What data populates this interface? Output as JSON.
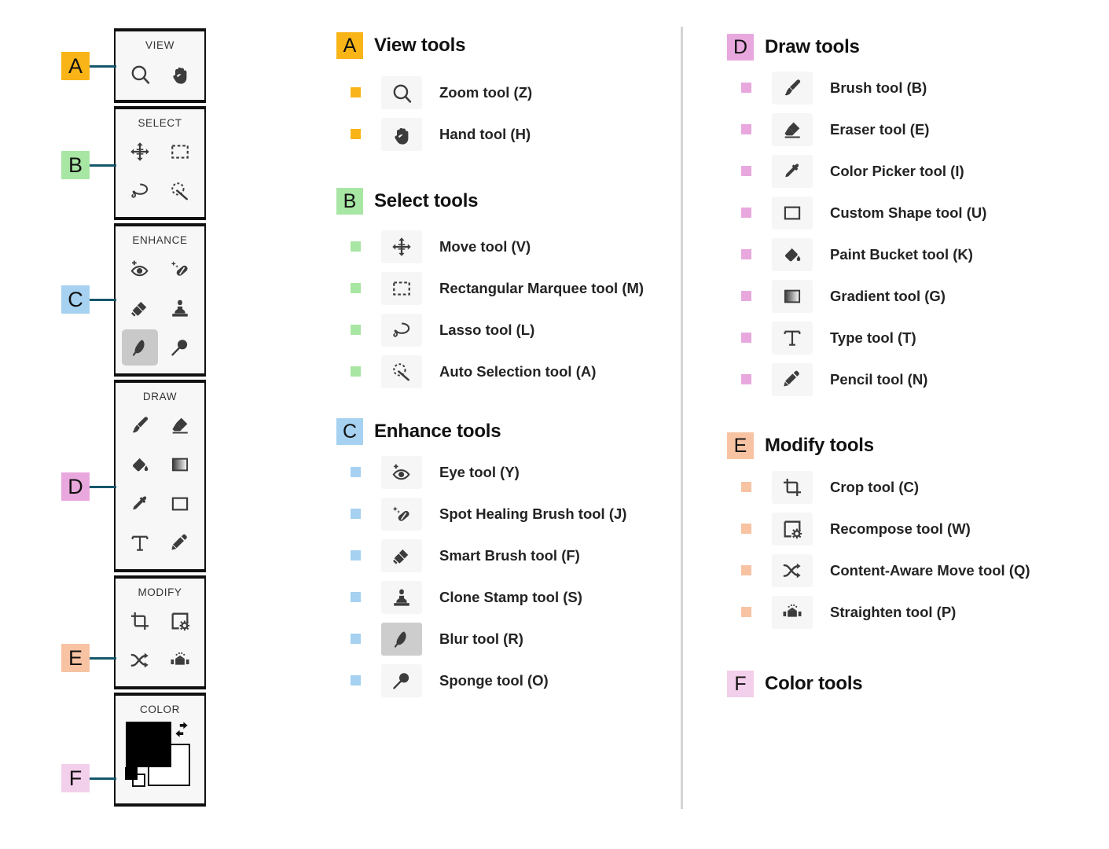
{
  "figure": {
    "type": "annotated-toolbar-diagram",
    "toolbar": {
      "panels": [
        {
          "key": "view",
          "title": "VIEW",
          "callout": "A",
          "callout_color": "#f9b418",
          "tools": [
            {
              "name": "zoom-tool-icon",
              "active": false
            },
            {
              "name": "hand-tool-icon",
              "active": false
            }
          ]
        },
        {
          "key": "select",
          "title": "SELECT",
          "callout": "B",
          "callout_color": "#a8e6a3",
          "tools": [
            {
              "name": "move-tool-icon",
              "active": false
            },
            {
              "name": "rectangular-marquee-tool-icon",
              "active": false
            },
            {
              "name": "lasso-tool-icon",
              "active": false
            },
            {
              "name": "auto-selection-tool-icon",
              "active": false
            }
          ]
        },
        {
          "key": "enhance",
          "title": "ENHANCE",
          "callout": "C",
          "callout_color": "#a6d1f0",
          "tools": [
            {
              "name": "eye-tool-icon",
              "active": false
            },
            {
              "name": "spot-healing-brush-tool-icon",
              "active": false
            },
            {
              "name": "smart-brush-tool-icon",
              "active": false
            },
            {
              "name": "clone-stamp-tool-icon",
              "active": false
            },
            {
              "name": "blur-tool-icon",
              "active": true
            },
            {
              "name": "sponge-tool-icon",
              "active": false
            }
          ]
        },
        {
          "key": "draw",
          "title": "DRAW",
          "callout": "D",
          "callout_color": "#e8a8dd",
          "tools": [
            {
              "name": "brush-tool-icon",
              "active": false
            },
            {
              "name": "eraser-tool-icon",
              "active": false
            },
            {
              "name": "paint-bucket-tool-icon",
              "active": false
            },
            {
              "name": "gradient-tool-icon",
              "active": false
            },
            {
              "name": "color-picker-tool-icon",
              "active": false
            },
            {
              "name": "custom-shape-tool-icon",
              "active": false
            },
            {
              "name": "type-tool-icon",
              "active": false
            },
            {
              "name": "pencil-tool-icon",
              "active": false
            }
          ]
        },
        {
          "key": "modify",
          "title": "MODIFY",
          "callout": "E",
          "callout_color": "#f7c3a3",
          "tools": [
            {
              "name": "crop-tool-icon",
              "active": false
            },
            {
              "name": "recompose-tool-icon",
              "active": false
            },
            {
              "name": "content-aware-move-tool-icon",
              "active": false
            },
            {
              "name": "straighten-tool-icon",
              "active": false
            }
          ]
        },
        {
          "key": "color",
          "title": "COLOR",
          "callout": "F",
          "callout_color": "#f2cfeb",
          "foreground_color": "#000000",
          "background_color": "#ffffff"
        }
      ]
    }
  },
  "legend": {
    "sections": [
      {
        "badge": "A",
        "badge_color": "#f9b418",
        "bullet_color": "#f9b418",
        "title": "View tools",
        "items": [
          {
            "icon": "zoom-tool-icon",
            "label": "Zoom tool (Z)",
            "active": false
          },
          {
            "icon": "hand-tool-icon",
            "label": "Hand tool (H)",
            "active": false
          }
        ]
      },
      {
        "badge": "B",
        "badge_color": "#a8e6a3",
        "bullet_color": "#a8e6a3",
        "title": "Select tools",
        "items": [
          {
            "icon": "move-tool-icon",
            "label": "Move tool (V)",
            "active": false
          },
          {
            "icon": "rectangular-marquee-tool-icon",
            "label": "Rectangular Marquee tool (M)",
            "active": false
          },
          {
            "icon": "lasso-tool-icon",
            "label": "Lasso tool (L)",
            "active": false
          },
          {
            "icon": "auto-selection-tool-icon",
            "label": "Auto Selection tool (A)",
            "active": false
          }
        ]
      },
      {
        "badge": "C",
        "badge_color": "#a6d1f0",
        "bullet_color": "#a6d1f0",
        "title": "Enhance tools",
        "items": [
          {
            "icon": "eye-tool-icon",
            "label": "Eye tool (Y)",
            "active": false
          },
          {
            "icon": "spot-healing-brush-tool-icon",
            "label": "Spot Healing Brush tool (J)",
            "active": false
          },
          {
            "icon": "smart-brush-tool-icon",
            "label": "Smart Brush tool (F)",
            "active": false
          },
          {
            "icon": "clone-stamp-tool-icon",
            "label": "Clone Stamp tool (S)",
            "active": false
          },
          {
            "icon": "blur-tool-icon",
            "label": "Blur tool (R)",
            "active": true
          },
          {
            "icon": "sponge-tool-icon",
            "label": "Sponge tool (O)",
            "active": false
          }
        ]
      },
      {
        "badge": "D",
        "badge_color": "#e8a8dd",
        "bullet_color": "#e8a8dd",
        "title": "Draw tools",
        "items": [
          {
            "icon": "brush-tool-icon",
            "label": "Brush tool (B)",
            "active": false
          },
          {
            "icon": "eraser-tool-icon",
            "label": "Eraser tool (E)",
            "active": false
          },
          {
            "icon": "color-picker-tool-icon",
            "label": "Color Picker tool (I)",
            "active": false
          },
          {
            "icon": "custom-shape-tool-icon",
            "label": "Custom Shape tool (U)",
            "active": false
          },
          {
            "icon": "paint-bucket-tool-icon",
            "label": "Paint Bucket tool (K)",
            "active": false
          },
          {
            "icon": "gradient-tool-icon",
            "label": "Gradient tool (G)",
            "active": false
          },
          {
            "icon": "type-tool-icon",
            "label": "Type tool (T)",
            "active": false
          },
          {
            "icon": "pencil-tool-icon",
            "label": "Pencil tool (N)",
            "active": false
          }
        ]
      },
      {
        "badge": "E",
        "badge_color": "#f7c3a3",
        "bullet_color": "#f7c3a3",
        "title": "Modify tools",
        "items": [
          {
            "icon": "crop-tool-icon",
            "label": "Crop tool (C)",
            "active": false
          },
          {
            "icon": "recompose-tool-icon",
            "label": "Recompose tool (W)",
            "active": false
          },
          {
            "icon": "content-aware-move-tool-icon",
            "label": "Content-Aware Move tool (Q)",
            "active": false
          },
          {
            "icon": "straighten-tool-icon",
            "label": "Straighten tool (P)",
            "active": false
          }
        ]
      },
      {
        "badge": "F",
        "badge_color": "#f2cfeb",
        "bullet_color": "#f2cfeb",
        "title": "Color tools",
        "items": []
      }
    ]
  },
  "colors": {
    "leader_line": "#15576b",
    "panel_bg": "#f7f7f7",
    "panel_border": "#111111",
    "icon": "#3c3c3c",
    "divider": "#d4d4d4",
    "active_cell": "#c9c9c9"
  }
}
